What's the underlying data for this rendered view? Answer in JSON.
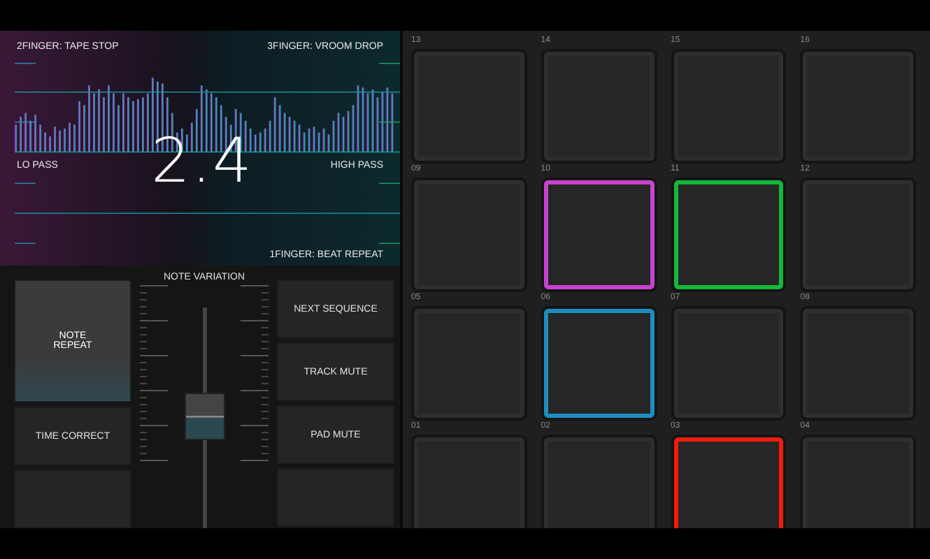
{
  "fx_pad": {
    "top_left": "2FINGER: TAPE STOP",
    "top_right": "3FINGER: VROOM DROP",
    "bottom_left_axis": "LO PASS",
    "bottom_right_axis": "HIGH PASS",
    "value": "2.4",
    "bottom_right": "1FINGER: BEAT REPEAT"
  },
  "left_buttons": [
    {
      "label": "NOTE\nREPEAT",
      "selected": true
    },
    {
      "label": "TIME CORRECT",
      "selected": false
    },
    {
      "selected": false
    }
  ],
  "note_variation": {
    "label": "NOTE VARIATION",
    "level": 0.55
  },
  "right_buttons": [
    {
      "label": "NEXT SEQUENCE",
      "selected": false
    },
    {
      "label": "TRACK MUTE",
      "selected": false
    },
    {
      "label": "PAD MUTE",
      "selected": false
    },
    {
      "selected": false
    }
  ],
  "pads": [
    {
      "number": "13"
    },
    {
      "number": "14"
    },
    {
      "number": "15"
    },
    {
      "number": "16"
    },
    {
      "number": "09"
    },
    {
      "number": "10",
      "color": "#c843d0"
    },
    {
      "number": "11",
      "color": "#14b83a"
    },
    {
      "number": "12"
    },
    {
      "number": "05"
    },
    {
      "number": "06",
      "color": "#1c8fc0"
    },
    {
      "number": "07"
    },
    {
      "number": "08"
    },
    {
      "number": "01"
    },
    {
      "number": "02"
    },
    {
      "number": "03",
      "color": "#f01c0c"
    },
    {
      "number": "04"
    }
  ]
}
